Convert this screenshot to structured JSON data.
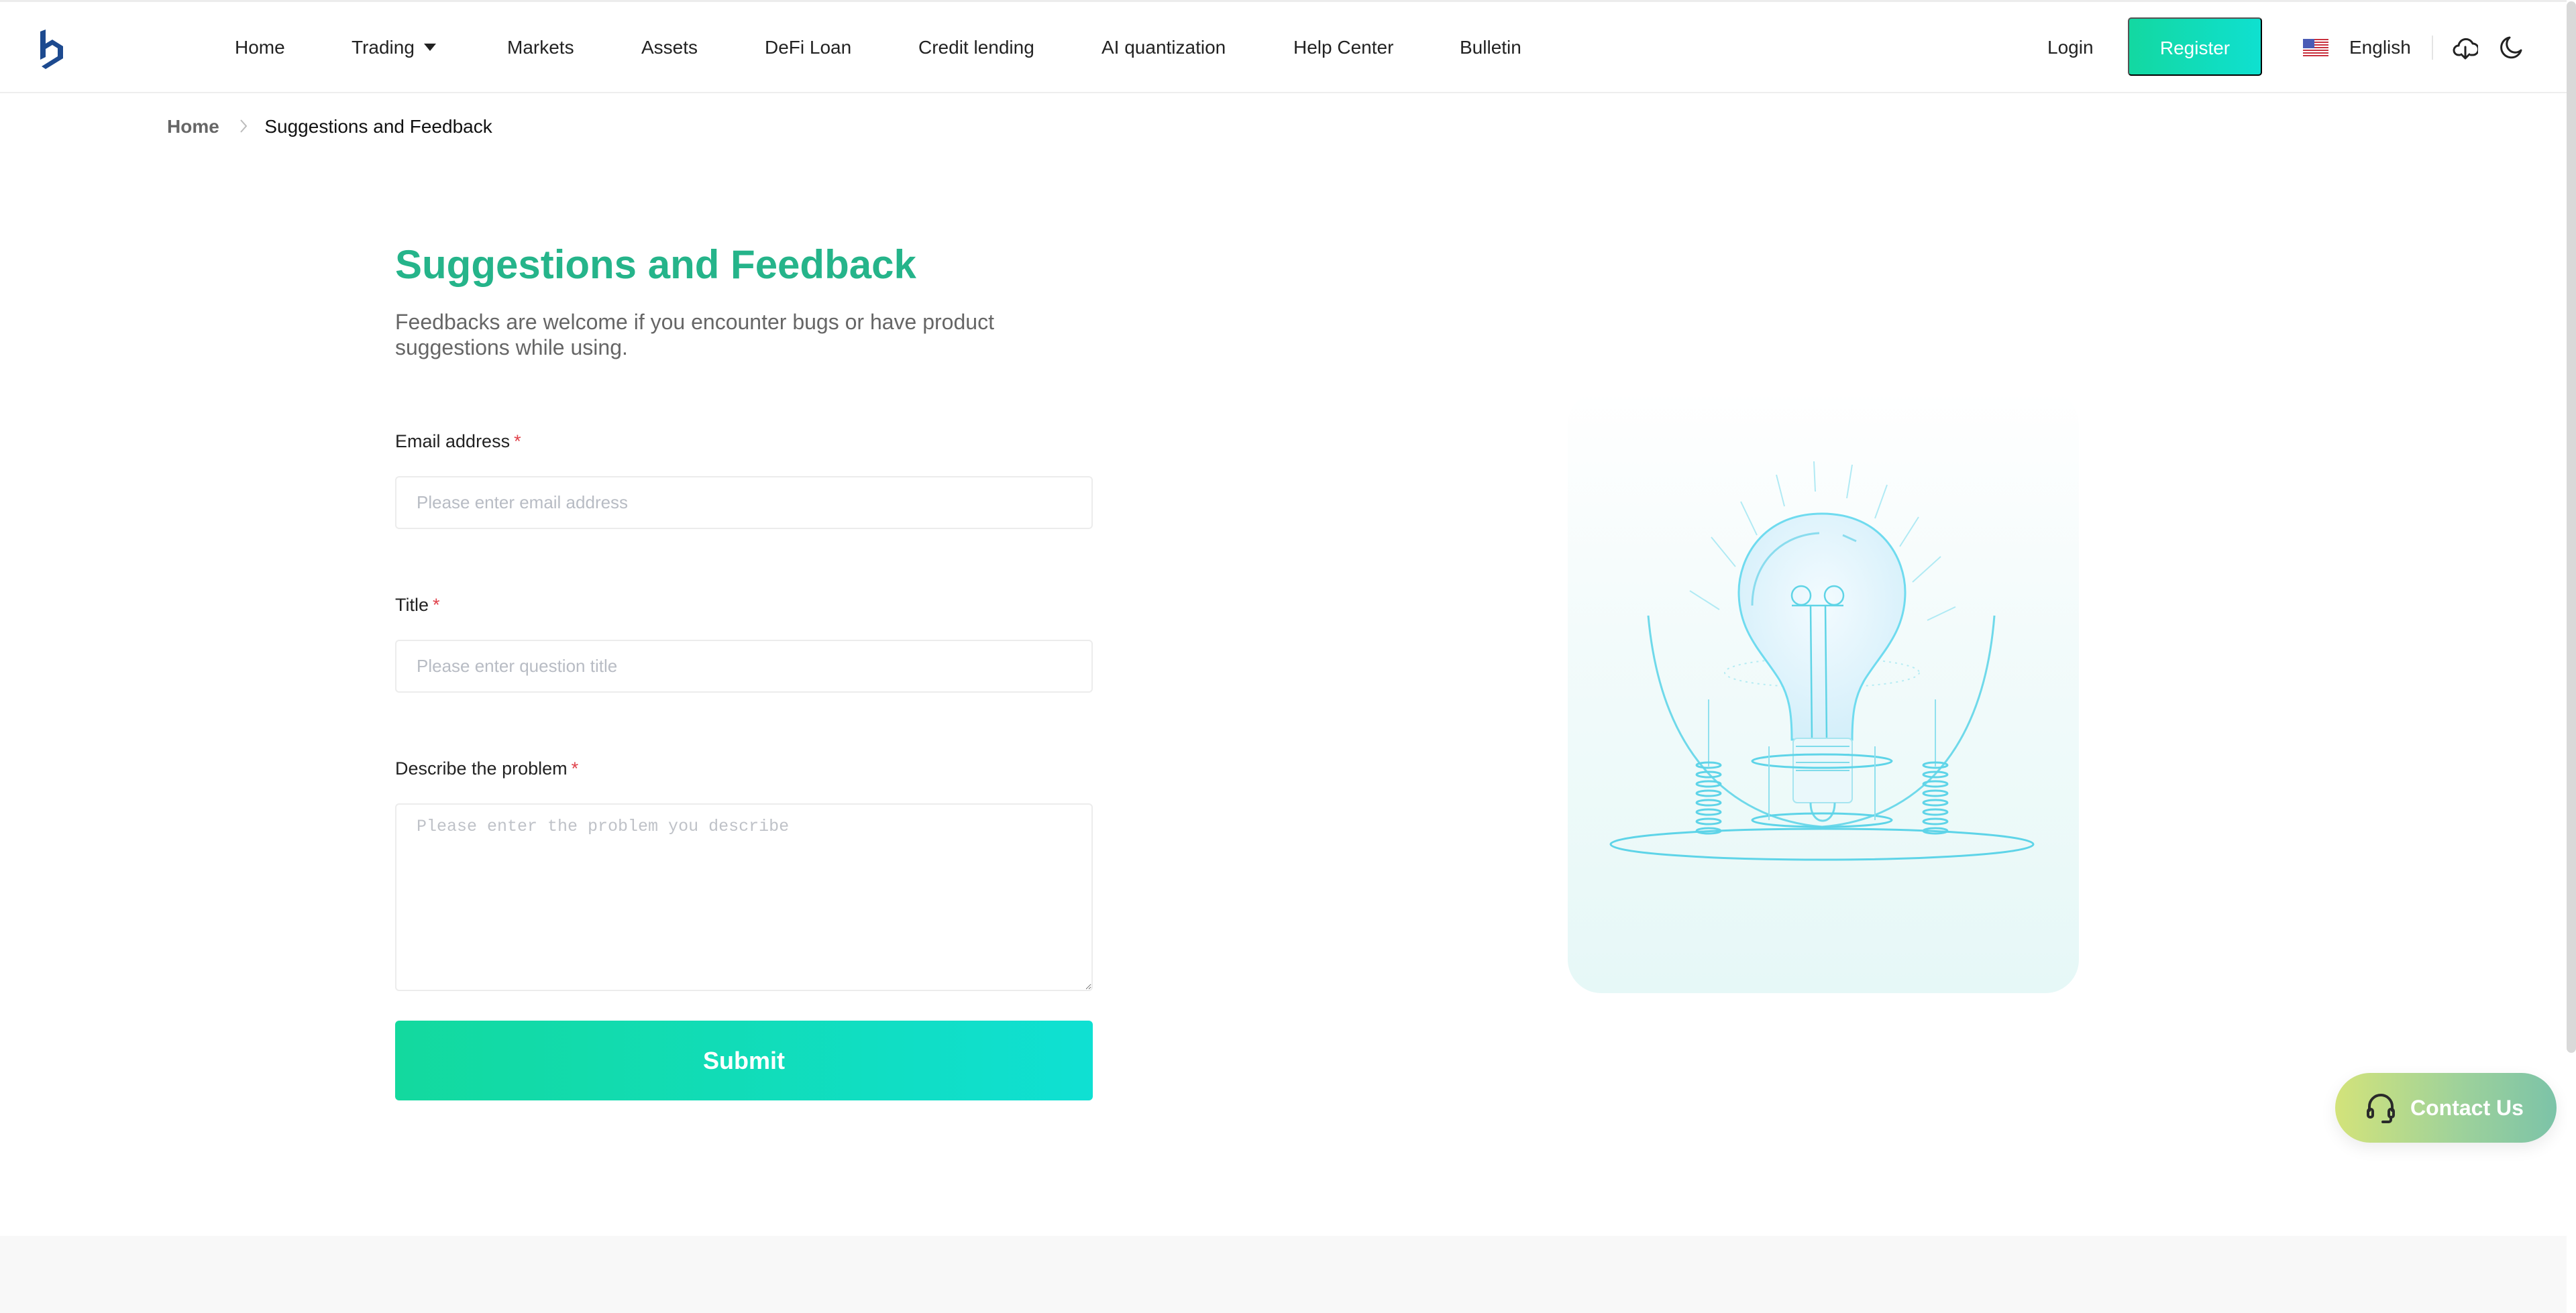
{
  "header": {
    "logo_alt": "logo",
    "nav": [
      {
        "label": "Home"
      },
      {
        "label": "Trading",
        "has_dropdown": true
      },
      {
        "label": "Markets"
      },
      {
        "label": "Assets"
      },
      {
        "label": "DeFi Loan"
      },
      {
        "label": "Credit lending"
      },
      {
        "label": "AI quantization"
      },
      {
        "label": "Help Center"
      },
      {
        "label": "Bulletin"
      }
    ],
    "login_label": "Login",
    "register_label": "Register",
    "language": "English",
    "language_flag": "us-flag-icon",
    "icons": [
      "cloud-download-icon",
      "moon-icon"
    ]
  },
  "breadcrumb": {
    "home": "Home",
    "separator_icon": "chevron-right-icon",
    "current": "Suggestions and Feedback"
  },
  "form": {
    "title": "Suggestions and Feedback",
    "description": "Feedbacks are welcome if you encounter bugs or have product suggestions while using.",
    "required_mark": "*",
    "email": {
      "label": "Email address",
      "value": "",
      "placeholder": "Please enter email address"
    },
    "title_field": {
      "label": "Title",
      "value": "",
      "placeholder": "Please enter question title"
    },
    "problem": {
      "label": "Describe the problem",
      "value": "",
      "placeholder": "Please enter the problem you describe"
    },
    "submit_label": "Submit"
  },
  "illustration": {
    "icon": "lightbulb-illustration"
  },
  "contact": {
    "label": "Contact Us",
    "icon": "headset-icon"
  },
  "colors": {
    "brand_green": "#25b48a",
    "button_gradient_start": "#13d99e",
    "button_gradient_end": "#0fe0d3",
    "required": "#e0424b",
    "logo_blue": "#1d4a8f"
  }
}
